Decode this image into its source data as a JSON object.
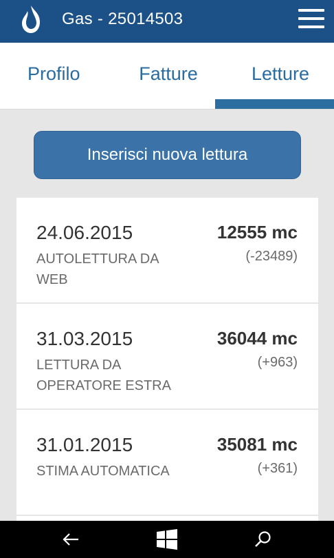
{
  "header": {
    "title": "Gas - 25014503",
    "logo_icon": "estra-flame-logo-icon",
    "menu_icon": "hamburger-menu-icon"
  },
  "tabs": [
    {
      "label": "Profilo",
      "active": false
    },
    {
      "label": "Fatture",
      "active": false
    },
    {
      "label": "Letture",
      "active": true
    }
  ],
  "actions": {
    "new_reading_label": "Inserisci nuova lettura"
  },
  "readings": [
    {
      "date": "24.06.2015",
      "source": "AUTOLETTURA DA WEB",
      "value": "12555 mc",
      "delta": "(-23489)"
    },
    {
      "date": "31.03.2015",
      "source": "LETTURA DA OPERATORE ESTRA",
      "value": "36044 mc",
      "delta": "(+963)"
    },
    {
      "date": "31.01.2015",
      "source": "STIMA AUTOMATICA",
      "value": "35081 mc",
      "delta": "(+361)"
    }
  ],
  "navbar": {
    "back_icon": "back-arrow-icon",
    "home_icon": "windows-logo-icon",
    "search_icon": "search-icon"
  },
  "colors": {
    "appbar": "#1b5187",
    "accent": "#2c6e9f",
    "button": "#3b72a8",
    "background": "#e6e6e6"
  }
}
